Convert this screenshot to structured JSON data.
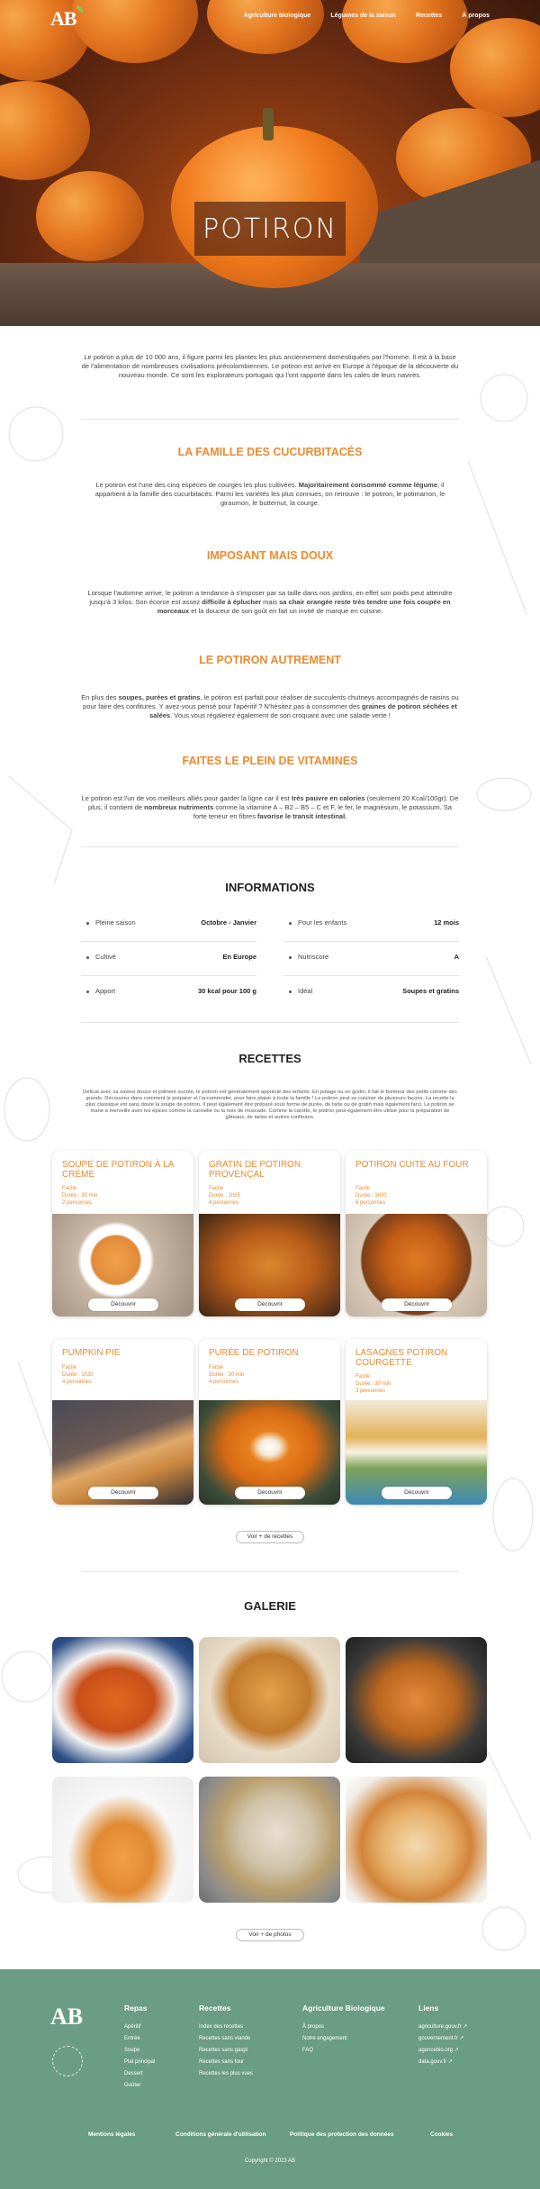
{
  "nav": {
    "logo": "AB",
    "items": [
      "Agriculture biologique",
      "Légumes de la saison",
      "Recettes",
      "À propos"
    ]
  },
  "hero": {
    "title": "POTIRON"
  },
  "intro": "Le potiron a plus de 10 000 ans, il figure parmi les plantes les plus anciennement domestiquées par l'homme. Il est à la base de l'alimentation de nombreuses civilisations précolombiennes. Le potiron est arrivé en Europe à l'époque de la découverte du nouveau monde. Ce sont les explorateurs portugais qui l'ont rapporté dans les cales de leurs navires.",
  "sections": [
    {
      "title": "LA FAMILLE DES CUCURBITACÉS",
      "parts": [
        {
          "t": "Le potiron est l'une des cinq espèces de courges les plus cultivées. ",
          "b": false
        },
        {
          "t": "Majoritairement consommé comme légume",
          "b": true
        },
        {
          "t": ", il appartient à la famille des cucurbitacés. Parmi les variétés les plus connues, on retrouve : le potiron, le potimarron, le giraumon, le butternut, la courge.",
          "b": false
        }
      ]
    },
    {
      "title": "IMPOSANT MAIS DOUX",
      "parts": [
        {
          "t": "Lorsque l'automne arrive, le potiron a tendance à s'imposer par sa taille dans nos jardins, en effet son poids peut atteindre jusqu'à 3 kilos. Son écorce est assez ",
          "b": false
        },
        {
          "t": "difficile à éplucher",
          "b": true
        },
        {
          "t": " mais ",
          "b": false
        },
        {
          "t": "sa chair orangée reste très tendre une fois coupée en morceaux",
          "b": true
        },
        {
          "t": " et la douceur de son goût en fait un invité de marque en cuisine.",
          "b": false
        }
      ]
    },
    {
      "title": "LE POTIRON AUTREMENT",
      "parts": [
        {
          "t": "En plus des ",
          "b": false
        },
        {
          "t": "soupes, purées et gratins",
          "b": true
        },
        {
          "t": ", le potiron est parfait pour réaliser de succulents chutneys accompagnés de raisins ou pour faire des confitures. Y avez-vous pensé pour l'apéritif ? N'hésitez pas à consommer des ",
          "b": false
        },
        {
          "t": "graines de potiron séchées et salées",
          "b": true
        },
        {
          "t": ". Vous vous régalerez également de son croquant avec une salade verte !",
          "b": false
        }
      ]
    },
    {
      "title": "FAITES LE PLEIN DE VITAMINES",
      "parts": [
        {
          "t": "Le potiron est l'un de vos meilleurs alliés pour garder la ligne car il est ",
          "b": false
        },
        {
          "t": "très pauvre en calories",
          "b": true
        },
        {
          "t": " (seulement 20 Kcal/100gr). De plus, il contient de ",
          "b": false
        },
        {
          "t": "nombreux nutriments",
          "b": true
        },
        {
          "t": " comme la vitamine A – B2 – B5 – C et F, le fer, le magnésium, le potassium. Sa forte teneur en fibres ",
          "b": false
        },
        {
          "t": "favorise le transit intestinal.",
          "b": true
        }
      ]
    }
  ],
  "info": {
    "title": "INFORMATIONS",
    "left": [
      {
        "label": "Pleine saison",
        "value": "Octobre - Janvier"
      },
      {
        "label": "Cultivé",
        "value": "En Europe"
      },
      {
        "label": "Apport",
        "value": "30 kcal pour 100 g"
      }
    ],
    "right": [
      {
        "label": "Pour les enfants",
        "value": "12 mois"
      },
      {
        "label": "Nutriscore",
        "value": "A"
      },
      {
        "label": "Idéal",
        "value": "Soupes et gratins"
      }
    ]
  },
  "recipes": {
    "title": "RECETTES",
    "intro": "Délicat avec sa saveur douce et joliment sucrée, le potiron est généralement apprécié des enfants. En potage ou en gratin, il fait le bonheur des petits comme des grands. Découvrez dans comment le préparer et l'accommoder, pour faire plaisir à toute la famille ! Le potiron peut se cuisiner de plusieurs façons. La recette la plus classique est sans doute la soupe de potiron. Il peut également être préparé sous forme de purée, de tarte ou de gratin mais également farci. Le potiron se marie à merveille avec les épices comme la cannelle ou la noix de muscade. Comme la carotte, le potiron peut également être utilisé pour la préparation de gâteaux, de tartes et autres confitures.",
    "cards": [
      {
        "title": "SOUPE DE POTIRON À LA CRÈME",
        "level": "Facile",
        "duration": "Durée : 30 min",
        "people": "2 personnes",
        "button": "Découvrir"
      },
      {
        "title": "GRATIN DE POTIRON PROVENÇAL",
        "level": "Facile",
        "duration": "Durée : 1h15",
        "people": "4 personnes",
        "button": "Découvrir"
      },
      {
        "title": "POTIRON CUITE AU FOUR",
        "level": "Facile",
        "duration": "Durée : 1h00",
        "people": "6 personnes",
        "button": "Découvrir"
      },
      {
        "title": "PUMPKIN PIE",
        "level": "Facile",
        "duration": "Durée : 1h30",
        "people": "4 personnes",
        "button": "Découvrir"
      },
      {
        "title": "PURÉE DE POTIRON",
        "level": "Facile",
        "duration": "Durée : 30 min",
        "people": "4 personnes",
        "button": "Découvrir"
      },
      {
        "title": "LASAGNES POTIRON COURGETTE",
        "level": "Facile",
        "duration": "Durée : 30 min",
        "people": "3 personnes",
        "button": "Découvrir"
      }
    ],
    "more": "Voir + de recettes"
  },
  "gallery": {
    "title": "GALERIE",
    "more": "Voir + de photos"
  },
  "footer": {
    "columns": [
      {
        "title": "Repas",
        "items": [
          "Apéritif",
          "Entrée",
          "Soupe",
          "Plat principal",
          "Dessert",
          "Goûter"
        ]
      },
      {
        "title": "Recettes",
        "items": [
          "Index des recettes",
          "Recettes sans viande",
          "Recettes sans gaspi",
          "Recettes sans four",
          "Recettes les plus vues"
        ]
      },
      {
        "title": "Agriculture Biologique",
        "items": [
          "À propos",
          "Notre engagement",
          "FAQ"
        ]
      },
      {
        "title": "Liens",
        "items": [
          "agriculture.gouv.fr ↗",
          "gouvernement.fr ↗",
          "agencebio.org ↗",
          "data.gouv.fr ↗"
        ]
      }
    ],
    "bottom": [
      "Mentions légales",
      "Conditions générale d'utilisation",
      "Politique des protection des données",
      "Cookies"
    ],
    "copyright": "Copyright © 2023 AB"
  },
  "colors": {
    "accent": "#ef8a2e",
    "footer": "#6b9c85"
  }
}
